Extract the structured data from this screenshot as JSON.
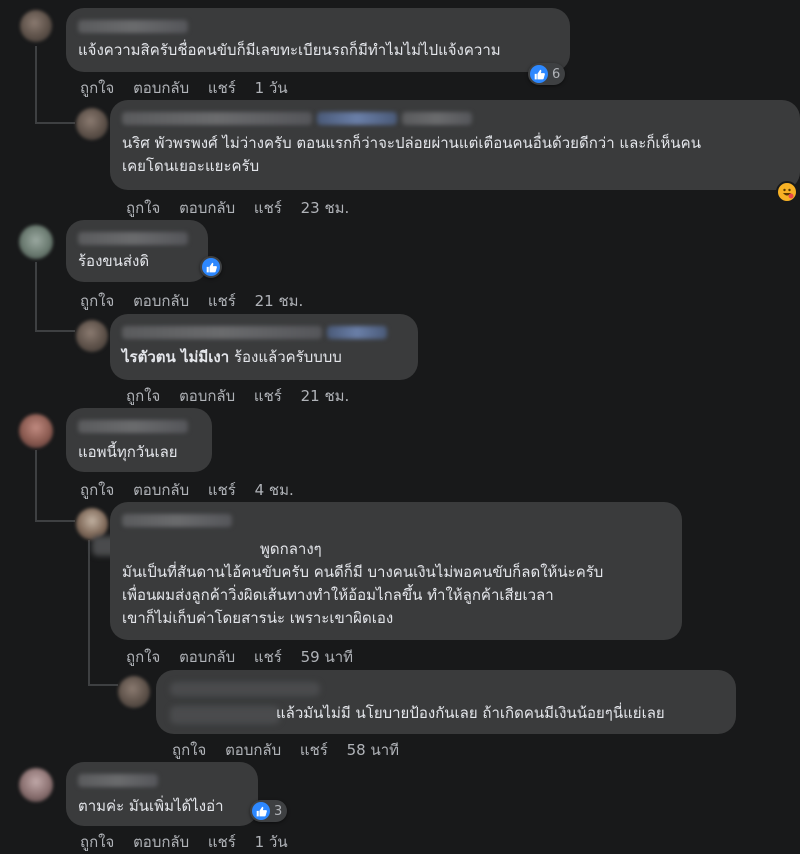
{
  "actions": {
    "like": "ถูกใจ",
    "reply": "ตอบกลับ",
    "share": "แชร์"
  },
  "comments": [
    {
      "text": "แจ้งความสิครับชื่อคนขับก็มีเลขทะเบียนรถก็มีทำไมไม่ไปแจ้งความ",
      "time": "1 วัน",
      "reactions": "6"
    },
    {
      "author": "นริศ พัวพรพงศ์",
      "text1": "ไม่ว่างครับ ตอนแรกก็ว่าจะปล่อยผ่านแต่เตือนคนอื่นด้วยดีกว่า และก็เห็นคน",
      "text2": "เคยโดนเยอะแยะครับ",
      "time": "23 ชม."
    },
    {
      "text": "ร้องขนส่งดิ",
      "time": "21 ชม."
    },
    {
      "author": "ไรตัวตน ไม่มีเงา",
      "text": "ร้องแล้วครับบบบ",
      "time": "21 ชม."
    },
    {
      "text": "แอพนี้ทุกวันเลย",
      "time": "4 ชม."
    },
    {
      "tag": "พูดกลางๆ",
      "line1": "มันเป็นที่สันดานไอ้คนขับครับ คนดีก็มี บางคนเงินไม่พอคนขับก็ลดให้น่ะครับ",
      "line2": "เพื่อนผมส่งลูกค้าวิ่งผิดเส้นทางทำให้อ้อมไกลขึ้น ทำให้ลูกค้าเสียเวลา",
      "line3": "เขาก็ไม่เก็บค่าโดยสารน่ะ เพราะเขาผิดเอง",
      "time": "59 นาที"
    },
    {
      "text": "แล้วมันไม่มี นโยบายป้องกันเลย ถ้าเกิดคนมีเงินน้อยๆนี่แย่เลย",
      "time": "58 นาที"
    },
    {
      "text": "ตามค่ะ มันเพิ่มได้ไงอ่า",
      "time": "1 วัน",
      "reactions": "3"
    }
  ]
}
